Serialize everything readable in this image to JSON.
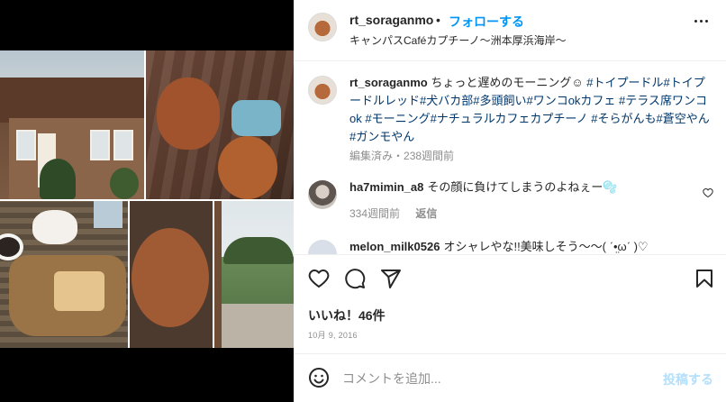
{
  "header": {
    "username": "rt_soraganmo",
    "separator": "•",
    "follow_label": "フォローする",
    "location": "キャンパスCaféカプチーノ〜洲本厚浜海岸〜"
  },
  "caption": {
    "username": "rt_soraganmo",
    "text": "ちょっと遅めのモーニング☺︎",
    "hashtags": "#トイプードル#トイプードルレッド#犬バカ部#多頭飼い#ワンコokカフェ #テラス席ワンコok #モーニング#ナチュラルカフェカプチーノ #そらがんも#蒼空やん#ガンモやん",
    "edited": "編集済み",
    "meta_separator": "・",
    "time": "238週間前"
  },
  "comments": [
    {
      "username": "ha7mimin_a8",
      "text": "その顔に負けてしまうのよねぇー🫧",
      "time": "334週間前",
      "reply_label": "返信"
    },
    {
      "username": "melon_milk0526",
      "text": "オシャレやな!!美味しそう〜〜( ˊ•̤ωˊ )♡",
      "time": "",
      "reply_label": ""
    }
  ],
  "actions": {
    "likes_text": "いいね！46件",
    "date": "10月 9, 2016"
  },
  "comment_box": {
    "placeholder": "コメントを追加...",
    "post_label": "投稿する"
  },
  "colors": {
    "accent": "#0095f6",
    "hashtag": "#00376b",
    "muted": "#8e8e8e",
    "post_disabled": "#b2dffc"
  },
  "icons": [
    "more-icon",
    "heart-icon",
    "comment-icon",
    "share-icon",
    "bookmark-icon",
    "emoji-icon",
    "heart-small-icon"
  ]
}
